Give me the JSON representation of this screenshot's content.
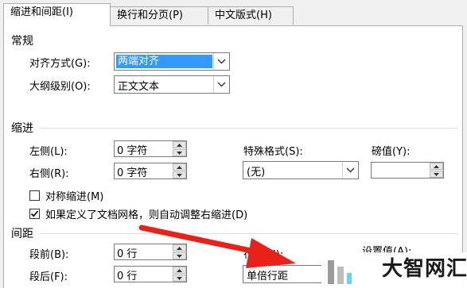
{
  "tabs": [
    {
      "label": "缩进和间距(I)",
      "active": true
    },
    {
      "label": "换行和分页(P)",
      "active": false
    },
    {
      "label": "中文版式(H)",
      "active": false
    }
  ],
  "general": {
    "title": "常规",
    "alignment_label": "对齐方式(G):",
    "alignment_value": "两端对齐",
    "outline_label": "大纲级别(O):",
    "outline_value": "正文文本"
  },
  "indent": {
    "title": "缩进",
    "left_label": "左侧(L):",
    "left_value": "0 字符",
    "right_label": "右侧(R):",
    "right_value": "0 字符",
    "special_label": "特殊格式(S):",
    "special_value": "(无)",
    "by_label": "磅值(Y):",
    "by_value": "",
    "mirror_label": "对称缩进(M)",
    "mirror_checked": false,
    "autoadjust_label": "如果定义了文档网格，则自动调整右缩进(D)",
    "autoadjust_checked": true
  },
  "spacing": {
    "title": "间距",
    "before_label": "段前(B):",
    "before_value": "0 行",
    "after_label": "段后(F):",
    "after_value": "0 行",
    "line_label": "行距(N):",
    "line_value": "单倍行距",
    "at_label": "设置值(A):"
  },
  "watermark": "大智网汇",
  "colors": {
    "accent": "#3399ff",
    "arrow": "#e8211b"
  }
}
